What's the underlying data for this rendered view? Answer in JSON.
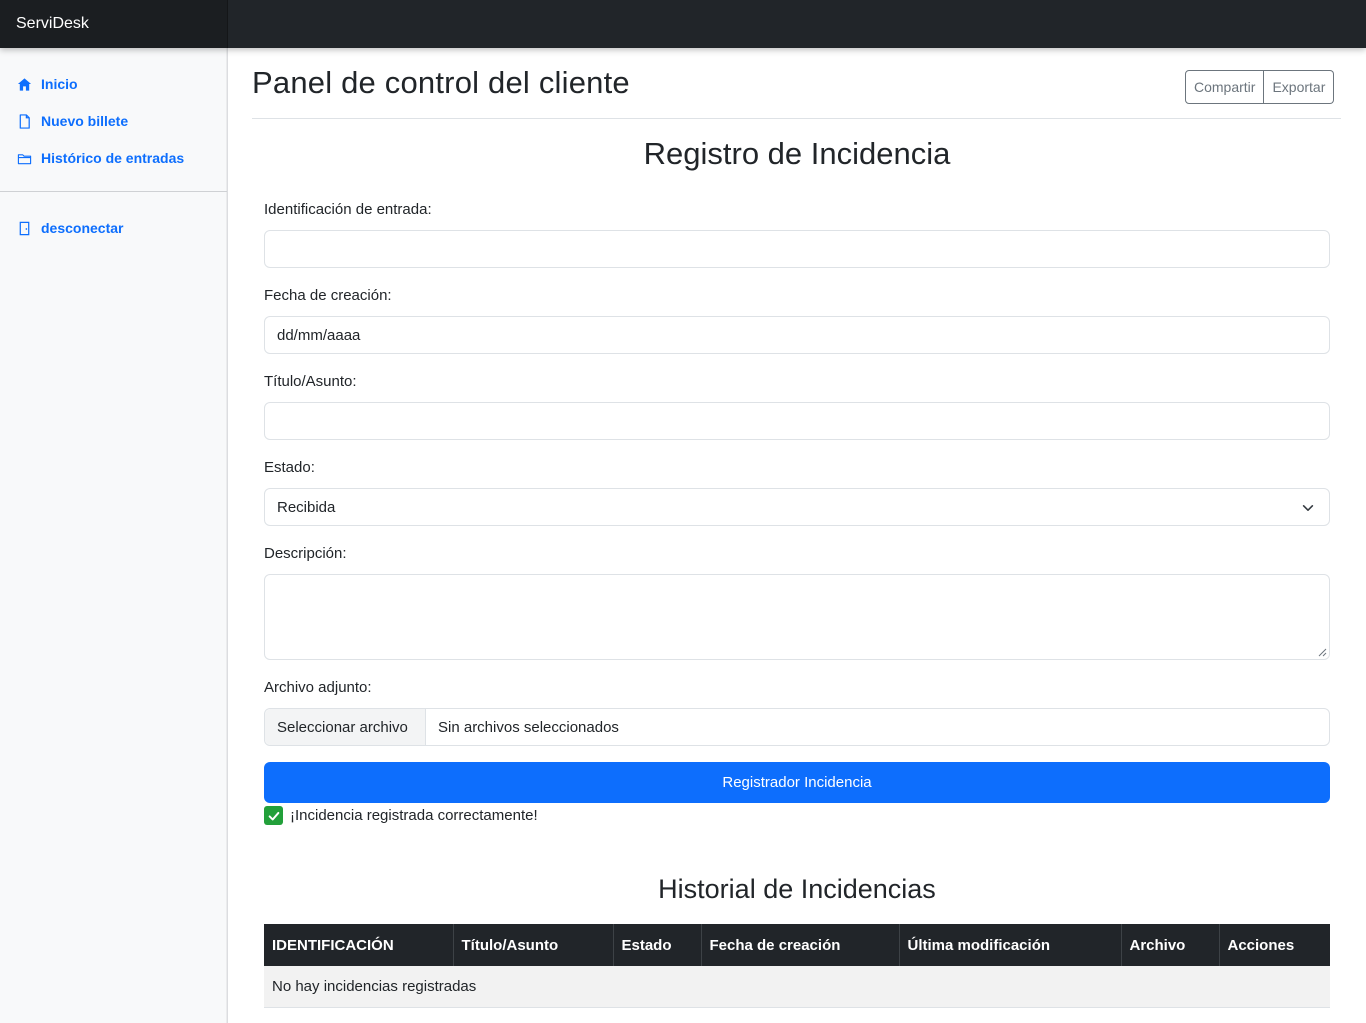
{
  "app": {
    "brand": "ServiDesk"
  },
  "sidebar": {
    "items": [
      {
        "label": "Inicio",
        "icon": "home-icon"
      },
      {
        "label": "Nuevo billete",
        "icon": "file-icon"
      },
      {
        "label": "Histórico de entradas",
        "icon": "folder-icon"
      }
    ],
    "logout": {
      "label": "desconectar",
      "icon": "door-icon"
    }
  },
  "header": {
    "title": "Panel de control del cliente",
    "share_label": "Compartir",
    "export_label": "Exportar"
  },
  "form": {
    "title": "Registro de Incidencia",
    "id_label": "Identificación de entrada:",
    "id_value": "",
    "date_label": "Fecha de creación:",
    "date_value": "dd/mm/aaaa",
    "subject_label": "Título/Asunto:",
    "subject_value": "",
    "status_label": "Estado:",
    "status_value": "Recibida",
    "description_label": "Descripción:",
    "description_value": "",
    "attachment_label": "Archivo adjunto:",
    "file_button": "Seleccionar archivo",
    "file_status": "Sin archivos seleccionados",
    "submit_label": "Registrador Incidencia",
    "success_message": "¡Incidencia registrada correctamente!"
  },
  "history": {
    "title": "Historial de Incidencias",
    "columns": [
      "IDENTIFICACIÓN",
      "Título/Asunto",
      "Estado",
      "Fecha de creación",
      "Última modificación",
      "Archivo",
      "Acciones"
    ],
    "empty_message": "No hay incidencias registradas"
  },
  "colors": {
    "navbar": "#212529",
    "accent": "#0d6efd",
    "success": "#22a03a",
    "sidebar_bg": "#f8f9fa"
  }
}
